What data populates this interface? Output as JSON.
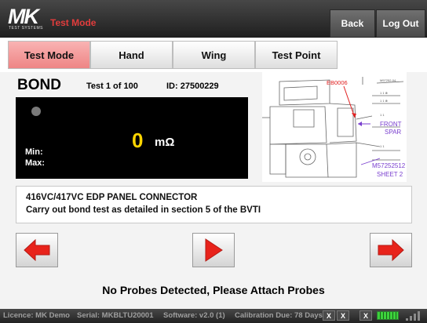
{
  "header": {
    "logo_text": "MK",
    "logo_subtext": "TEST SYSTEMS",
    "mode_title": "Test Mode",
    "back_label": "Back",
    "logout_label": "Log Out"
  },
  "tabs": [
    {
      "label": "Test Mode",
      "active": true
    },
    {
      "label": "Hand",
      "active": false
    },
    {
      "label": "Wing",
      "active": false
    },
    {
      "label": "Test Point",
      "active": false
    }
  ],
  "test": {
    "type": "BOND",
    "count": "Test 1 of 100",
    "id": "ID: 27500229"
  },
  "meter": {
    "value": "0",
    "unit": "mΩ",
    "min_label": "Min:",
    "max_label": "Max:"
  },
  "drawing": {
    "label_eb": "EB0006",
    "label_front": "FRONT",
    "label_spar": "SPAR",
    "label_ref": "M57252512",
    "label_sheet": "SHEET 2"
  },
  "instruction": {
    "line1": "416VC/417VC EDP PANEL CONNECTOR",
    "line2": "Carry out bond test as detailed in section 5 of the BVTI"
  },
  "navigation": {
    "prev_icon": "arrow-left-icon",
    "run_icon": "play-icon",
    "next_icon": "arrow-right-icon"
  },
  "message": "No Probes Detected, Please Attach Probes",
  "status": {
    "licence": "Licence: MK Demo",
    "serial": "Serial: MKBLTU20001",
    "software": "Software: v2.0 (1)",
    "calibration": "Calibration Due: 78 Days",
    "indicator1": "X",
    "indicator2": "X",
    "indicator3": "X"
  },
  "colors": {
    "accent": "#e02020",
    "meter_value": "#ffd500",
    "active_tab": "#f4a0a0",
    "drawing_annotation": "#7a3fcf"
  }
}
